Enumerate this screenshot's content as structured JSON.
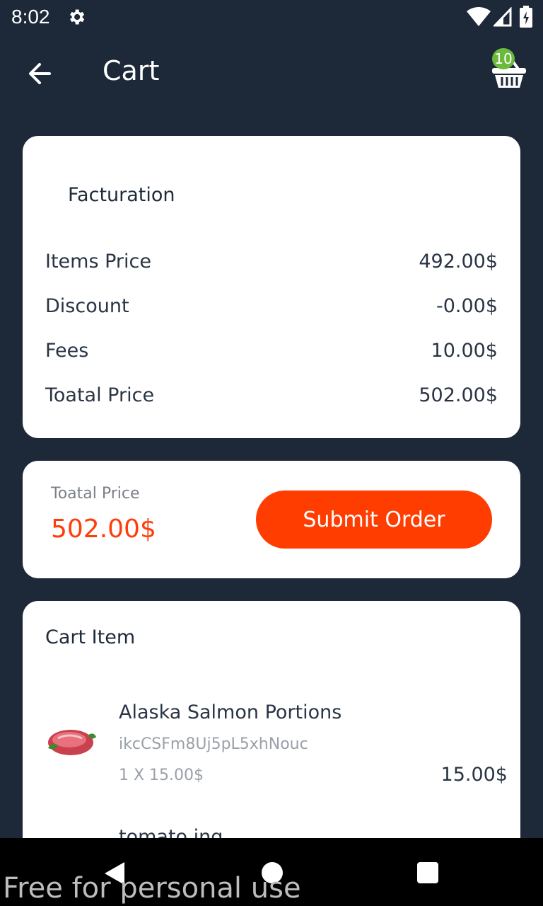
{
  "status_bar": {
    "time": "8:02"
  },
  "app_bar": {
    "title": "Cart",
    "cart_count": "10"
  },
  "facturation": {
    "title": "Facturation",
    "rows": [
      {
        "label": "Items Price",
        "value": "492.00$"
      },
      {
        "label": "Discount",
        "value": "-0.00$"
      },
      {
        "label": "Fees",
        "value": "10.00$"
      },
      {
        "label": "Toatal Price",
        "value": "502.00$"
      }
    ]
  },
  "total_card": {
    "label": "Toatal Price",
    "value": "502.00$",
    "submit_label": "Submit Order"
  },
  "cart_items": {
    "title": "Cart Item",
    "items": [
      {
        "name": "Alaska Salmon Portions",
        "sku": "ikcCSFm8Uj5pL5xhNouc",
        "qty": "1 X 15.00$",
        "price": "15.00$"
      },
      {
        "name": "tomato ing",
        "sku": "",
        "qty": "",
        "price": ""
      }
    ]
  },
  "watermark": "Free for personal use",
  "colors": {
    "background": "#1d2839",
    "accent": "#ff3d00",
    "badge": "#6cba3c"
  }
}
